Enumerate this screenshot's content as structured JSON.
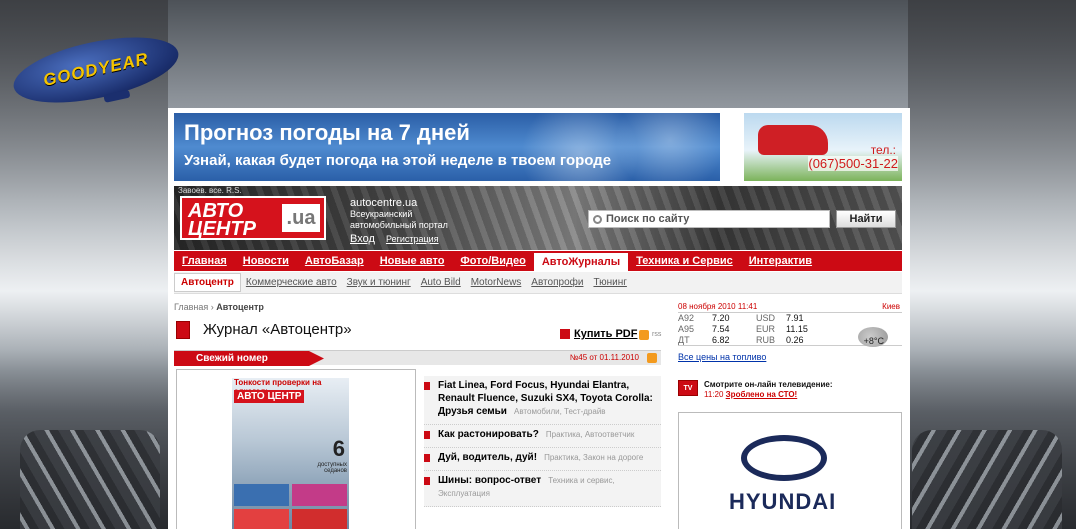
{
  "background": {
    "blimp_text": "GOODYEAR"
  },
  "ads": {
    "weather_banner": {
      "title": "Прогноз погоды на 7 дней",
      "subtitle": "Узнай, какая будет погода на этой неделе в твоем городе"
    },
    "car_ad": {
      "tel_label": "тел.:",
      "phone": "(067)500-31-22"
    }
  },
  "header": {
    "toplinks": "Завоев. все. R.S.",
    "logo_left": "АВТО",
    "logo_right": "ЦЕНТР",
    "logo_ua": ".ua",
    "site": "autocentre.ua",
    "tagline_1": "Всеукраинский",
    "tagline_2": "автомобильный портал",
    "login": "Вход",
    "register": "Регистрация",
    "search_placeholder": "Поиск по сайту",
    "search_button": "Найти"
  },
  "nav": {
    "items": [
      "Главная",
      "Новости",
      "АвтоБазар",
      "Новые авто",
      "Фото/Видео",
      "АвтоЖурналы",
      "Техника и Сервис",
      "Интерактив"
    ],
    "active": "АвтоЖурналы"
  },
  "subnav": {
    "items": [
      "Автоцентр",
      "Коммерческие авто",
      "Звук и тюнинг",
      "Auto Bild",
      "MotorNews",
      "Автопрофи",
      "Тюнинг"
    ]
  },
  "breadcrumb": {
    "home": "Главная",
    "current": "Автоцентр"
  },
  "page": {
    "title": "Журнал «Автоцентр»",
    "buy_pdf": "Купить PDF",
    "rss_small": "rss"
  },
  "fresh": {
    "label": "Свежий номер",
    "issue": "№45 от 01.11.2010"
  },
  "cover": {
    "top": "Тонкости проверки на алкоголь",
    "logo": "АВТО ЦЕНТР",
    "big_num": "6",
    "sub": "доступных седанов"
  },
  "articles": [
    {
      "title": "Fiat Linea, Ford Focus, Hyundai Elantra, Renault Fluence, Suzuki SX4, Toyota Corolla: Друзья семьи",
      "cat": "Автомобили, Тест-драйв"
    },
    {
      "title": "Как растонировать?",
      "cat": "Практика, Автоответчик"
    },
    {
      "title": "Дуй, водитель, дуй!",
      "cat": "Практика, Закон на дороге"
    },
    {
      "title": "Шины: вопрос-ответ",
      "cat": "Техника и сервис, Эксплуатация"
    }
  ],
  "info": {
    "date": "08 ноября 2010 11:41",
    "city": "Киев",
    "fuel": [
      {
        "name": "А92",
        "price": "7.20",
        "cur": "USD",
        "rate": "7.91"
      },
      {
        "name": "А95",
        "price": "7.54",
        "cur": "EUR",
        "rate": "11.15"
      },
      {
        "name": "ДТ",
        "price": "6.82",
        "cur": "RUB",
        "rate": "0.26"
      }
    ],
    "temp": "+8°C",
    "all_fuel": "Все цены на топливо",
    "tv_label": "TV",
    "tv_text": "Смотрите он-лайн телевидение:",
    "tv_time": "11:20",
    "tv_show": "Зроблено на СТО!",
    "hy_brand": "HYUNDAI"
  },
  "colors": {
    "accent": "#cc0a14",
    "link": "#0033aa"
  }
}
